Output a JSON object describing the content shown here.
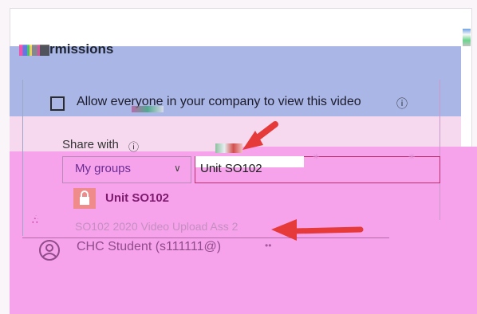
{
  "permissions": {
    "title": "rmissions",
    "allow_label": "Allow everyone in your company to view this video",
    "info_glyph": "ⓘ"
  },
  "share": {
    "label": "Share with",
    "info_glyph": "ⓘ",
    "scope_value": "My groups",
    "chevron": "∨",
    "search_value": "Unit SO102"
  },
  "results": [
    {
      "label": "Unit SO102",
      "icon": "lock-icon"
    },
    {
      "label": "SO102 2020 Video Upload Ass 2",
      "icon": "group-icon"
    },
    {
      "label": "CHC Student (s111111@)",
      "icon": "user-icon"
    }
  ],
  "colors": {
    "accent": "#c12f6f",
    "lock_bg": "#f08b8b",
    "arrow": "#e63a3a",
    "overlay_pink": "#f7a3ec",
    "overlay_blue": "#aab6e6"
  }
}
